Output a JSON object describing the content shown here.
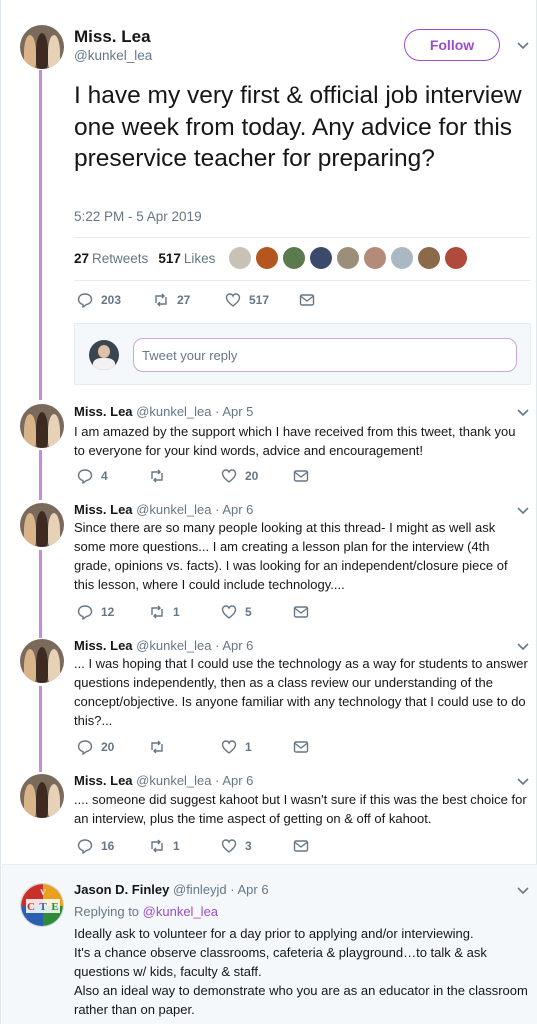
{
  "main_tweet": {
    "name": "Miss. Lea",
    "handle": "@kunkel_lea",
    "follow_label": "Follow",
    "text": "I have my very first & official job interview one week from today. Any advice for this preservice teacher for preparing?",
    "time": "5:22 PM - 5 Apr 2019",
    "retweets_count": "27",
    "retweets_label": "Retweets",
    "likes_count": "517",
    "likes_label": "Likes",
    "actions": {
      "replies": "203",
      "retweets": "27",
      "likes": "517"
    }
  },
  "reply_box": {
    "placeholder": "Tweet your reply"
  },
  "replies": [
    {
      "name": "Miss. Lea",
      "meta": "@kunkel_lea · Apr 5",
      "text": "I am amazed by the support which I have received from this tweet, thank you to everyone for your kind words, advice and encouragement!",
      "replies": "4",
      "retweets": "",
      "likes": "20"
    },
    {
      "name": "Miss. Lea",
      "meta": "@kunkel_lea · Apr 6",
      "text": "Since there are so many people looking at this thread- I might as well ask some more questions... I am creating a lesson plan for the interview (4th grade, opinions vs. facts). I was looking for an independent/closure piece of this lesson, where I could include technology....",
      "replies": "12",
      "retweets": "1",
      "likes": "5"
    },
    {
      "name": "Miss. Lea",
      "meta": "@kunkel_lea · Apr 6",
      "text": "... I was hoping that I could use the technology as a way for students to answer questions independently, then as a class review our understanding of the concept/objective. Is anyone familiar with any technology that I could use to do this?...",
      "replies": "20",
      "retweets": "",
      "likes": "1"
    },
    {
      "name": "Miss. Lea",
      "meta": "@kunkel_lea · Apr 6",
      "text": ".... someone did suggest kahoot but I wasn't sure if this was the best choice for an interview, plus the time aspect of getting on & off of kahoot.",
      "replies": "16",
      "retweets": "1",
      "likes": "3"
    }
  ],
  "last_reply": {
    "name": "Jason D. Finley",
    "meta": "@finleyjd · Apr 6",
    "replying_to_label": "Replying to",
    "replying_to_handle": "@kunkel_lea",
    "avatar_letters": [
      "V",
      "C",
      "T",
      "E"
    ],
    "lines": [
      "Ideally ask to volunteer for a day prior to applying and/or interviewing.",
      "It's a chance observe classrooms, cafeteria & playground…to talk & ask questions w/ kids, faculty & staff.",
      "Also an ideal way to demonstrate who you are as an educator in the classroom rather than on paper."
    ]
  },
  "colors": {
    "accent": "#9b4dca",
    "thread_line": "#c48ce6",
    "muted": "#657786",
    "text": "#14171a"
  },
  "icons": [
    "reply-icon",
    "retweet-icon",
    "like-icon",
    "message-icon",
    "chevron-down-icon"
  ]
}
